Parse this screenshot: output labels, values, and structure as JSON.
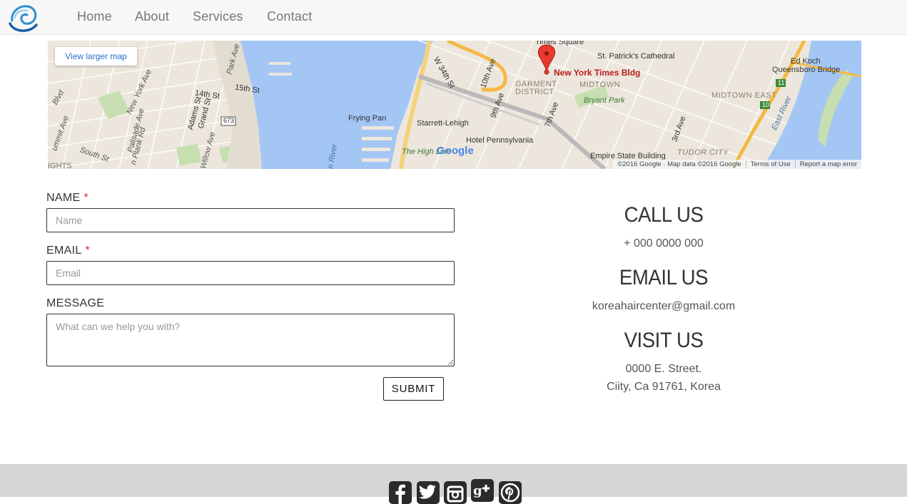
{
  "nav": {
    "logo_icon": "swirl-logo-icon",
    "items": [
      {
        "label": "Home"
      },
      {
        "label": "About"
      },
      {
        "label": "Services"
      },
      {
        "label": "Contact"
      }
    ]
  },
  "map": {
    "larger_map_link": "View larger map",
    "marker_label": "New York Times Bldg",
    "labels": {
      "times_square": "Times Square",
      "st_patricks": "St. Patrick's Cathedral",
      "ed_koch": "Ed Koch",
      "queensboro": "Queensboro Bridge",
      "w34": "W 34th St",
      "tenth_ave": "10th Ave",
      "ninth_ave": "9th Ave",
      "seventh_ave": "7th Ave",
      "third_ave": "3rd Ave",
      "garment": "GARMENT",
      "district": "DISTRICT",
      "midtown": "MIDTOWN",
      "midtown_east": "MIDTOWN EAST",
      "bryant_park": "Bryant Park",
      "frying_pan": "Frying Pan",
      "starrett": "Starrett-Lehigh",
      "hotel_penn": "Hotel Pennsylvania",
      "high_line": "The High Line",
      "empire": "Empire State Building",
      "tudor": "TUDOR CITY",
      "east_river": "East River",
      "hudson": "son River",
      "park_ave": "Park Ave",
      "fifteenth": "15th St",
      "fourteenth": "14th St",
      "adams": "Adams St",
      "grand": "Grand St",
      "palisade": "Palisade Ave",
      "new_york_ave": "New York Ave",
      "summit": "ummit Ave",
      "blvd": "Blvd",
      "south_st": "South St",
      "plank": "n Plank Rd",
      "willow": "Willow Ave",
      "route_673": "673",
      "route_11": "11",
      "route_10": "10",
      "heights": "IGHTS",
      "google": "Google"
    },
    "attribution": {
      "copyright": "©2016 Google · Map data ©2016 Google",
      "terms": "Terms of Use",
      "report": "Report a map error"
    },
    "colors": {
      "water": "#a3c6f5",
      "land": "#ece6dc",
      "park": "#c7deb0",
      "highway": "#f4b945",
      "marker": "#e8392f"
    }
  },
  "form": {
    "name_label": "NAME",
    "name_required": "*",
    "name_placeholder": "Name",
    "email_label": "EMAIL",
    "email_required": "*",
    "email_placeholder": "Email",
    "message_label": "MESSAGE",
    "message_placeholder": "What can we help you with?",
    "submit_label": "SUBMIT"
  },
  "contact": {
    "call_heading": "CALL US",
    "phone": "+ 000 0000 000",
    "email_heading": "EMAIL US",
    "email": "koreahaircenter@gmail.com",
    "visit_heading": "VISIT US",
    "address_line1": "0000 E. Street.",
    "address_line2": "Ciity, Ca 91761, Korea"
  },
  "footer": {
    "social_icons": [
      "facebook-icon",
      "twitter-icon",
      "instagram-icon",
      "google-plus-icon",
      "pinterest-icon"
    ],
    "colors": {
      "background": "#d6d6d6",
      "icon": "#2b2b2b"
    }
  }
}
